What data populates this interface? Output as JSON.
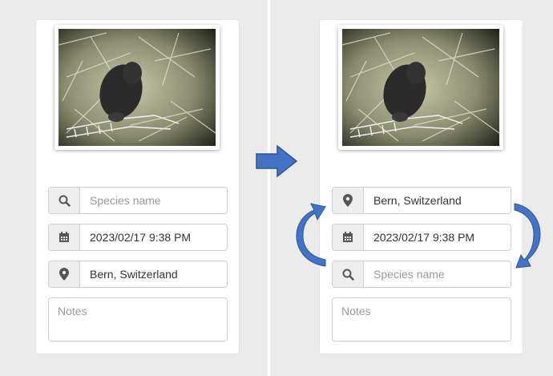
{
  "left_panel": {
    "search_placeholder": "Species name",
    "datetime_value": "2023/02/17 9:38 PM",
    "location_value": "Bern, Switzerland",
    "notes_placeholder": "Notes"
  },
  "right_panel": {
    "location_value": "Bern, Switzerland",
    "datetime_value": "2023/02/17 9:38 PM",
    "search_placeholder": "Species name",
    "notes_placeholder": "Notes"
  },
  "colors": {
    "arrow": "#4472c4",
    "background": "#ebebeb",
    "card": "#ffffff",
    "addon": "#eeeeee"
  },
  "icons": [
    "search-icon",
    "calendar-icon",
    "location-pin-icon",
    "right-arrow-icon",
    "curved-arrow-icon"
  ]
}
